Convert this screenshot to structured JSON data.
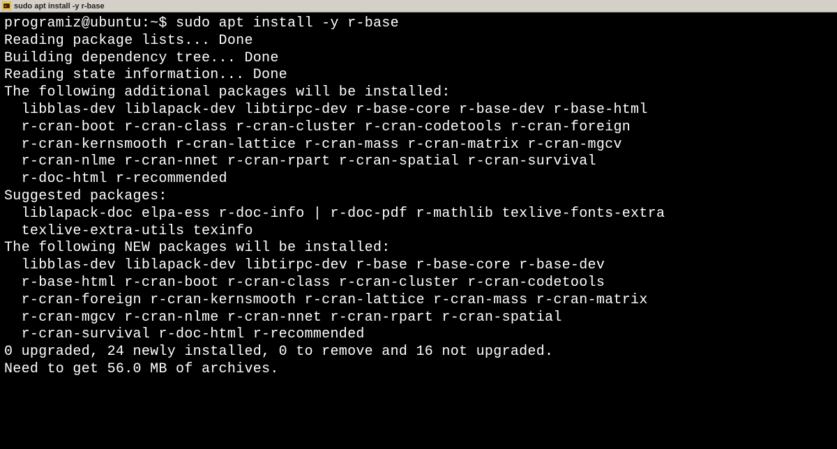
{
  "window": {
    "title": "sudo apt install -y r-base"
  },
  "terminal": {
    "prompt": "programiz@ubuntu:~$ ",
    "command": "sudo apt install -y r-base",
    "lines": [
      "Reading package lists... Done",
      "Building dependency tree... Done",
      "Reading state information... Done",
      "The following additional packages will be installed:",
      "  libblas-dev liblapack-dev libtirpc-dev r-base-core r-base-dev r-base-html",
      "  r-cran-boot r-cran-class r-cran-cluster r-cran-codetools r-cran-foreign",
      "  r-cran-kernsmooth r-cran-lattice r-cran-mass r-cran-matrix r-cran-mgcv",
      "  r-cran-nlme r-cran-nnet r-cran-rpart r-cran-spatial r-cran-survival",
      "  r-doc-html r-recommended",
      "Suggested packages:",
      "  liblapack-doc elpa-ess r-doc-info | r-doc-pdf r-mathlib texlive-fonts-extra",
      "  texlive-extra-utils texinfo",
      "The following NEW packages will be installed:",
      "  libblas-dev liblapack-dev libtirpc-dev r-base r-base-core r-base-dev",
      "  r-base-html r-cran-boot r-cran-class r-cran-cluster r-cran-codetools",
      "  r-cran-foreign r-cran-kernsmooth r-cran-lattice r-cran-mass r-cran-matrix",
      "  r-cran-mgcv r-cran-nlme r-cran-nnet r-cran-rpart r-cran-spatial",
      "  r-cran-survival r-doc-html r-recommended",
      "0 upgraded, 24 newly installed, 0 to remove and 16 not upgraded.",
      "Need to get 56.0 MB of archives."
    ]
  }
}
